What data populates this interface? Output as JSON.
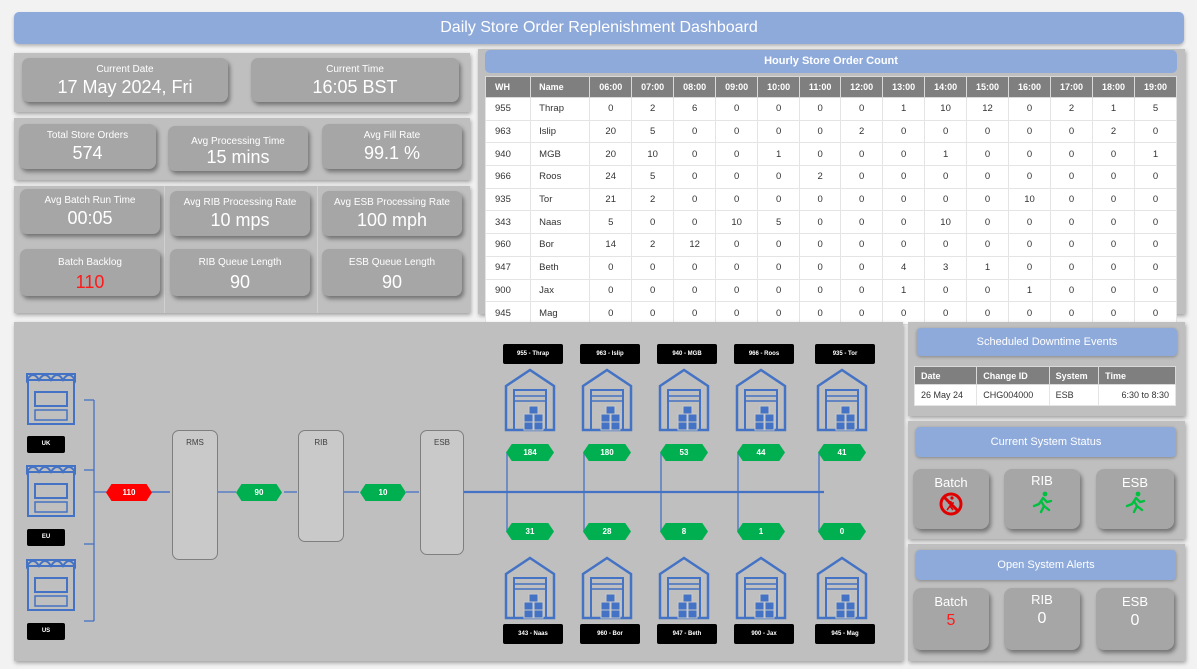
{
  "title": "Daily Store Order Replenishment Dashboard",
  "kpis": {
    "current_date": {
      "label": "Current Date",
      "value": "17 May 2024, Fri"
    },
    "current_time": {
      "label": "Current Time",
      "value": "16:05 BST"
    },
    "total_orders": {
      "label": "Total Store Orders",
      "value": "574"
    },
    "avg_proc_time": {
      "label": "Avg Processing Time",
      "value": "15 mins"
    },
    "avg_fill_rate": {
      "label": "Avg Fill Rate",
      "value": "99.1 %"
    },
    "avg_batch_run": {
      "label": "Avg Batch Run Time",
      "value": "00:05"
    },
    "avg_rib_rate": {
      "label": "Avg  RIB Processing Rate",
      "value": "10 mps"
    },
    "avg_esb_rate": {
      "label": "Avg  ESB Processing Rate",
      "value": "100 mph"
    },
    "batch_backlog": {
      "label": "Batch Backlog",
      "value": "110"
    },
    "rib_queue": {
      "label": "RIB Queue Length",
      "value": "90"
    },
    "esb_queue": {
      "label": "ESB Queue Length",
      "value": "90"
    }
  },
  "hourly": {
    "title": "Hourly Store Order Count",
    "columns": [
      "WH",
      "Name",
      "06:00",
      "07:00",
      "08:00",
      "09:00",
      "10:00",
      "11:00",
      "12:00",
      "13:00",
      "14:00",
      "15:00",
      "16:00",
      "17:00",
      "18:00",
      "19:00"
    ],
    "rows": [
      [
        "955",
        "Thrap",
        "0",
        "2",
        "6",
        "0",
        "0",
        "0",
        "0",
        "1",
        "10",
        "12",
        "0",
        "2",
        "1",
        "5"
      ],
      [
        "963",
        "Islip",
        "20",
        "5",
        "0",
        "0",
        "0",
        "0",
        "2",
        "0",
        "0",
        "0",
        "0",
        "0",
        "2",
        "0"
      ],
      [
        "940",
        "MGB",
        "20",
        "10",
        "0",
        "0",
        "1",
        "0",
        "0",
        "0",
        "1",
        "0",
        "0",
        "0",
        "0",
        "1"
      ],
      [
        "966",
        "Roos",
        "24",
        "5",
        "0",
        "0",
        "0",
        "2",
        "0",
        "0",
        "0",
        "0",
        "0",
        "0",
        "0",
        "0"
      ],
      [
        "935",
        "Tor",
        "21",
        "2",
        "0",
        "0",
        "0",
        "0",
        "0",
        "0",
        "0",
        "0",
        "10",
        "0",
        "0",
        "0"
      ],
      [
        "343",
        "Naas",
        "5",
        "0",
        "0",
        "10",
        "5",
        "0",
        "0",
        "0",
        "10",
        "0",
        "0",
        "0",
        "0",
        "0"
      ],
      [
        "960",
        "Bor",
        "14",
        "2",
        "12",
        "0",
        "0",
        "0",
        "0",
        "0",
        "0",
        "0",
        "0",
        "0",
        "0",
        "0"
      ],
      [
        "947",
        "Beth",
        "0",
        "0",
        "0",
        "0",
        "0",
        "0",
        "0",
        "4",
        "3",
        "1",
        "0",
        "0",
        "0",
        "0"
      ],
      [
        "900",
        "Jax",
        "0",
        "0",
        "0",
        "0",
        "0",
        "0",
        "0",
        "1",
        "0",
        "0",
        "1",
        "0",
        "0",
        "0"
      ],
      [
        "945",
        "Mag",
        "0",
        "0",
        "0",
        "0",
        "0",
        "0",
        "0",
        "0",
        "0",
        "0",
        "0",
        "0",
        "0",
        "0"
      ]
    ]
  },
  "downtime": {
    "title": "Scheduled Downtime Events",
    "columns": [
      "Date",
      "Change ID",
      "System",
      "Time"
    ],
    "rows": [
      [
        "26 May 24",
        "CHG004000",
        "ESB",
        "6:30 to 8:30"
      ]
    ]
  },
  "system_status": {
    "title": "Current System Status",
    "items": [
      {
        "label": "Batch",
        "state": "stopped",
        "icon": "no-pedestrian-icon"
      },
      {
        "label": "RIB",
        "state": "running",
        "icon": "running-person-icon"
      },
      {
        "label": "ESB",
        "state": "running",
        "icon": "running-person-icon"
      }
    ]
  },
  "alerts": {
    "title": "Open System Alerts",
    "items": [
      {
        "label": "Batch",
        "value": "5"
      },
      {
        "label": "RIB",
        "value": "0"
      },
      {
        "label": "ESB",
        "value": "0"
      }
    ]
  },
  "flow": {
    "regions": [
      "UK",
      "EU",
      "US"
    ],
    "systems": [
      "RMS",
      "RIB",
      "ESB"
    ],
    "queues": [
      "110",
      "90",
      "10"
    ],
    "top_stores": [
      {
        "label": "955 - Thrap",
        "count": "184"
      },
      {
        "label": "963 - Islip",
        "count": "180"
      },
      {
        "label": "940 - MGB",
        "count": "53"
      },
      {
        "label": "966 - Roos",
        "count": "44"
      },
      {
        "label": "935 - Tor",
        "count": "41"
      }
    ],
    "bottom_stores": [
      {
        "label": "343 - Naas",
        "count": "31"
      },
      {
        "label": "960 - Bor",
        "count": "28"
      },
      {
        "label": "947 - Beth",
        "count": "8"
      },
      {
        "label": "900 - Jax",
        "count": "1"
      },
      {
        "label": "945 - Mag",
        "count": "0"
      }
    ],
    "colors": {
      "ok": "#00b050",
      "alert": "#ff0000",
      "line": "#4472c4"
    }
  }
}
